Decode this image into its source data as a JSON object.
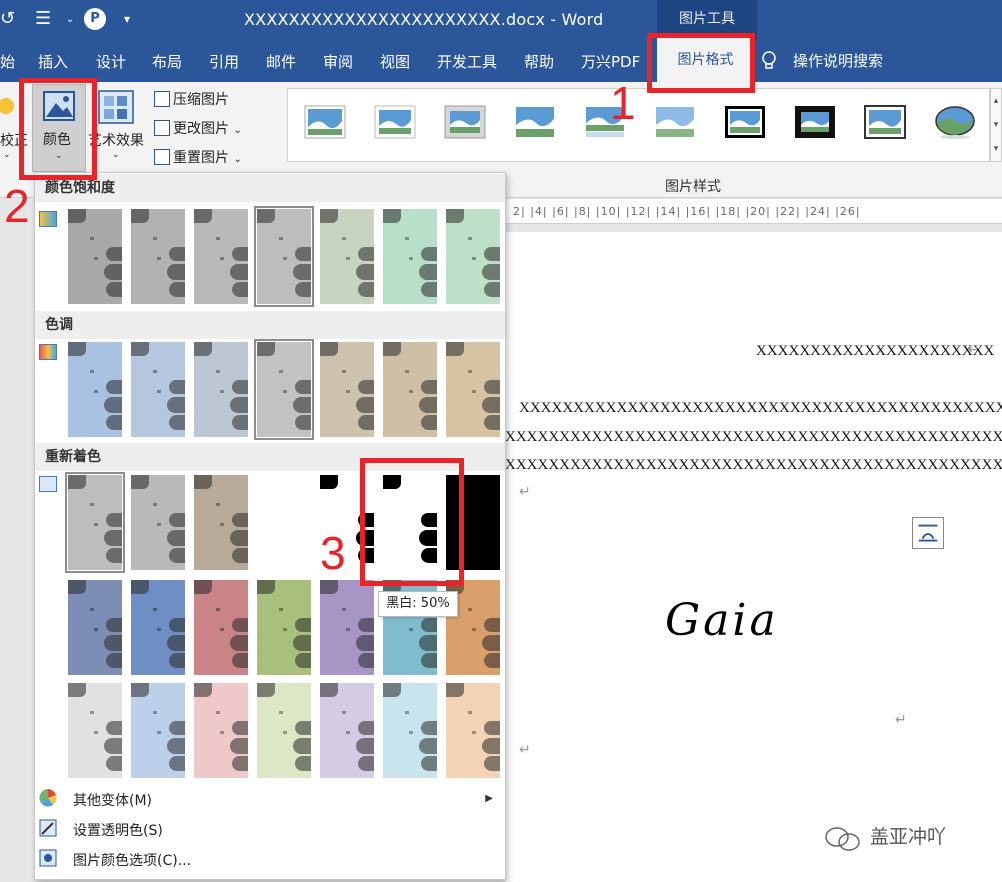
{
  "titlebar": {
    "document_title": "XXXXXXXXXXXXXXXXXXXXXXX.docx  -  Word",
    "tools_label": "图片工具"
  },
  "tabs": {
    "items": [
      "始",
      "插入",
      "设计",
      "布局",
      "引用",
      "邮件",
      "审阅",
      "视图",
      "开发工具",
      "帮助",
      "万兴PDF"
    ],
    "active": "图片格式",
    "search": "操作说明搜索"
  },
  "ribbon": {
    "correct_label": "校正",
    "color_label": "颜色",
    "art_effects_label": "艺术效果",
    "compress_label": "压缩图片",
    "change_label": "更改图片",
    "reset_label": "重置图片",
    "styles_group_label": "图片样式"
  },
  "ruler": {
    "text": "2|  |4|  |6|  |8|  |10|  |12|  |14|  |16|  |18|  |20|  |22|  |24|  |26|"
  },
  "document": {
    "line1": "XXXXXXXXXXXXXXXXXXXXXX",
    "line2": "XXXXXXXXXXXXXXXXXXXXXXXXXXXXXXXXXXXXXXXXXXXXXXXX",
    "line3": "XXXXXXXXXXXXXXXXXXXXXXXXXXXXXXXXXXXXXXXXXXXXXXXXX",
    "line4": "XXXXXXXXXXXXXXXXXXXXXXXXXXXXXXXXXXXXXXXXXXXXXXXXX",
    "signature": "Gaia",
    "watermark": "盖亚冲吖"
  },
  "dropdown": {
    "saturation_header": "颜色饱和度",
    "tone_header": "色调",
    "recolor_header": "重新着色",
    "more_variations": "其他变体(M)",
    "set_transparent": "设置透明色(S)",
    "color_options": "图片颜色选项(C)...",
    "tooltip": "黑白: 50%",
    "saturation_colors": [
      "#a9a9a9",
      "#b2b2b2",
      "#b9b9b9",
      "#bdbdbd",
      "#c8d3c2",
      "#b8dfc9",
      "#bfe0c8"
    ],
    "tone_colors": [
      "#a9c2e2",
      "#b4c7df",
      "#bcc7d3",
      "#c2c2c2",
      "#cdc2ad",
      "#cfbfa6",
      "#d6c3a4"
    ],
    "recolor_row1": [
      "#bdbdbd",
      "#b9b9b9",
      "#b8aa98",
      "#ffffff",
      "#ffffff",
      "#ffffff",
      "#000000"
    ],
    "recolor_row2": [
      "#7c8eb6",
      "#6f8ec4",
      "#c98487",
      "#a8c07c",
      "#a796c5",
      "#7fbccd",
      "#d9a06c"
    ],
    "recolor_row3": [
      "#e1e1e1",
      "#bcd0ea",
      "#efc9c9",
      "#dce8c5",
      "#d4cbe4",
      "#c8e4ec",
      "#f2d3b6"
    ]
  },
  "annotations": {
    "n1": "1",
    "n2": "2",
    "n3": "3"
  },
  "colors": {
    "word_blue": "#2b579a",
    "annotation_red": "#e8232a"
  }
}
